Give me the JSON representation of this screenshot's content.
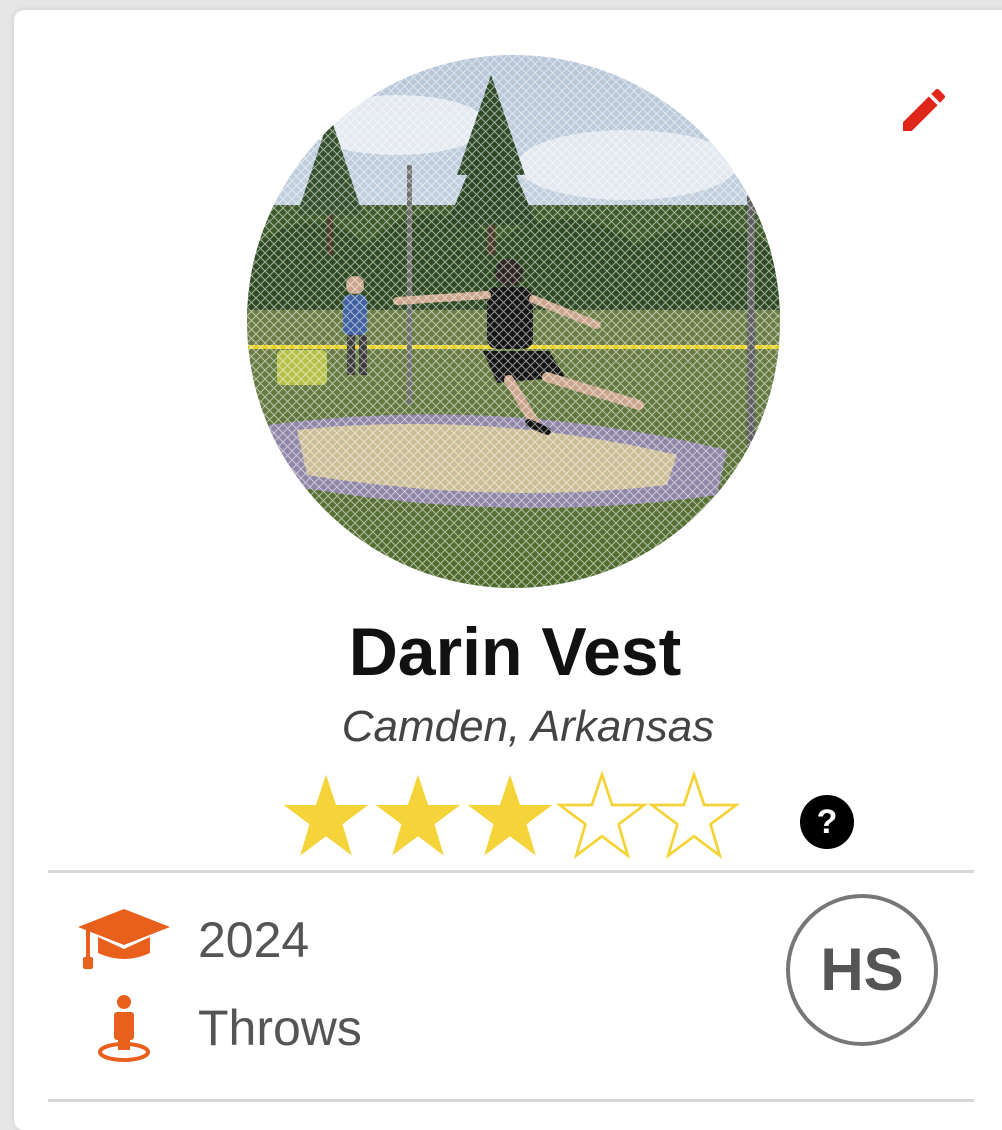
{
  "profile": {
    "name": "Darin Vest",
    "location": "Camden, Arkansas",
    "rating": 3,
    "rating_max": 5,
    "help_label": "?",
    "class_year": "2024",
    "event_group": "Throws",
    "level_badge": "HS"
  },
  "icons": {
    "edit": "pencil-icon",
    "help": "question-icon",
    "class_year": "graduation-cap-icon",
    "event_group": "person-location-icon"
  },
  "colors": {
    "accent": "#e8601c",
    "edit": "#e0251b",
    "star_filled": "#f5d43a",
    "star_outline": "#f5d43a"
  }
}
